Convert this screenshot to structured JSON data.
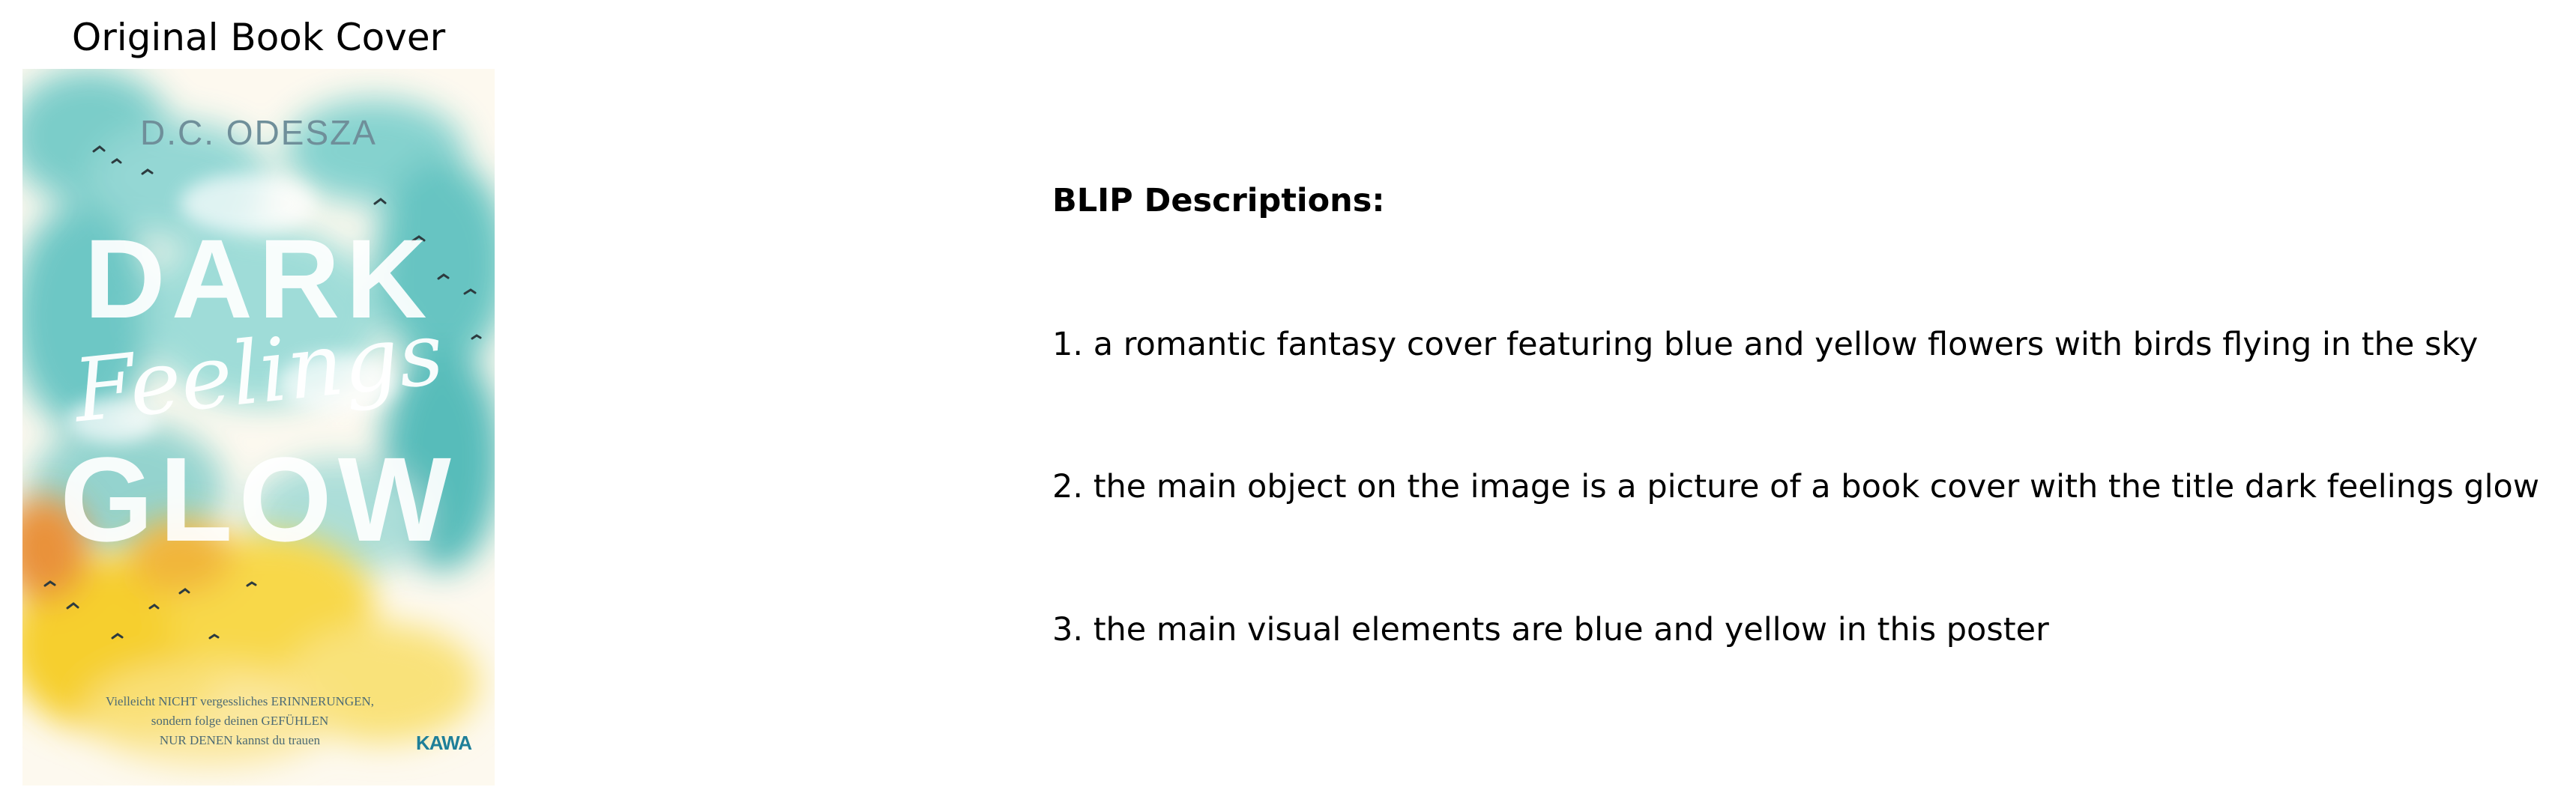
{
  "figure": {
    "cover_title": "Original Book Cover",
    "cover": {
      "author": "D.C. ODESZA",
      "title_line_1": "DARK",
      "title_line_2": "Feelings",
      "title_line_3": "GLOW",
      "blurb": [
        "Vielleicht NICHT vergessliches ERINNERUNGEN,",
        "sondern folge deinen GEFÜHLEN",
        "NUR DENEN kannst du trauen"
      ],
      "publisher": "KAWA",
      "colors": {
        "background": "#fdf9ef",
        "teal": "#6ecbc9",
        "yellow": "#f6cf2e",
        "orange": "#e9923a"
      }
    },
    "descriptions_heading": "BLIP Descriptions:",
    "descriptions": [
      "1. a romantic fantasy cover featuring blue and yellow flowers with birds flying in the sky",
      "2. the main object on the image is a picture of a book cover with the title dark feelings glow",
      "3. the main visual elements are blue and yellow in this poster"
    ]
  }
}
